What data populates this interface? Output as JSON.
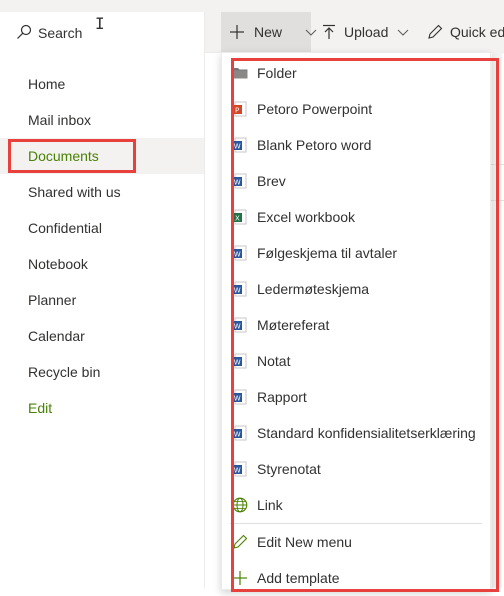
{
  "search": {
    "label": "Search"
  },
  "nav": {
    "items": [
      {
        "label": "Home"
      },
      {
        "label": "Mail inbox"
      },
      {
        "label": "Documents"
      },
      {
        "label": "Shared with us"
      },
      {
        "label": "Confidential"
      },
      {
        "label": "Notebook"
      },
      {
        "label": "Planner"
      },
      {
        "label": "Calendar"
      },
      {
        "label": "Recycle bin"
      },
      {
        "label": "Edit"
      }
    ],
    "selected": "Documents"
  },
  "commandbar": {
    "new_label": "New",
    "upload_label": "Upload",
    "quick_edit_label": "Quick ed"
  },
  "menu": {
    "items": [
      {
        "label": "Folder",
        "icon": "folder-icon"
      },
      {
        "label": "Petoro Powerpoint",
        "icon": "powerpoint-icon"
      },
      {
        "label": "Blank Petoro word",
        "icon": "word-icon"
      },
      {
        "label": "Brev",
        "icon": "word-icon"
      },
      {
        "label": "Excel workbook",
        "icon": "excel-icon"
      },
      {
        "label": "Følgeskjema til avtaler",
        "icon": "word-icon"
      },
      {
        "label": "Ledermøteskjema",
        "icon": "word-icon"
      },
      {
        "label": "Møtereferat",
        "icon": "word-icon"
      },
      {
        "label": "Notat",
        "icon": "word-icon"
      },
      {
        "label": "Rapport",
        "icon": "word-icon"
      },
      {
        "label": "Standard konfidensialitetserklæring",
        "icon": "word-icon"
      },
      {
        "label": "Styrenotat",
        "icon": "word-icon"
      },
      {
        "label": "Link",
        "icon": "globe-icon"
      }
    ],
    "footer": [
      {
        "label": "Edit New menu",
        "icon": "pencil-icon"
      },
      {
        "label": "Add template",
        "icon": "plus-icon"
      }
    ]
  },
  "colors": {
    "accent_green": "#498205",
    "highlight_red": "#e8403d",
    "word_blue": "#2b579a",
    "excel_green": "#217346",
    "powerpoint_red": "#d24726"
  }
}
